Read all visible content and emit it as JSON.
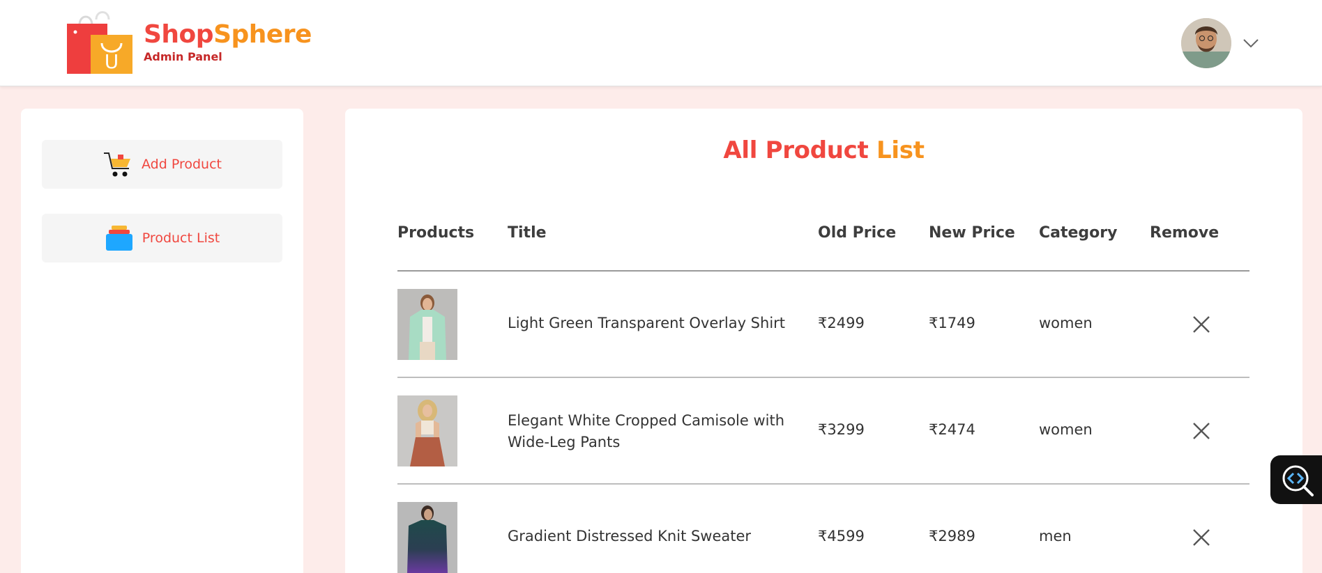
{
  "header": {
    "brand_part1": "Shop",
    "brand_part2": "Sphere",
    "subtitle": "Admin Panel",
    "logo_icon": "shopping-bag-icon",
    "avatar_icon": "user-avatar",
    "dropdown_icon": "chevron-down-icon"
  },
  "sidebar": {
    "items": [
      {
        "label": "Add Product",
        "icon": "cart-icon"
      },
      {
        "label": "Product List",
        "icon": "stack-icon"
      }
    ]
  },
  "main": {
    "title_part1": "All Product",
    "title_part2": "List",
    "columns": [
      "Products",
      "Title",
      "Old Price",
      "New Price",
      "Category",
      "Remove"
    ],
    "rows": [
      {
        "title_line1": "Light Green Transparent Overlay Shirt",
        "title_line2": "",
        "old_price": "₹2499",
        "new_price": "₹1749",
        "category": "women"
      },
      {
        "title_line1": "Elegant White Cropped Camisole with",
        "title_line2": "Wide-Leg Pants",
        "old_price": "₹3299",
        "new_price": "₹2474",
        "category": "women"
      },
      {
        "title_line1": "Gradient Distressed Knit Sweater",
        "title_line2": "",
        "old_price": "₹4599",
        "new_price": "₹2989",
        "category": "men"
      }
    ]
  },
  "colors": {
    "brand_red": "#f0473f",
    "brand_orange": "#f7931e",
    "page_bg": "#fdecea"
  },
  "floating_tool_icon": "code-search-icon"
}
